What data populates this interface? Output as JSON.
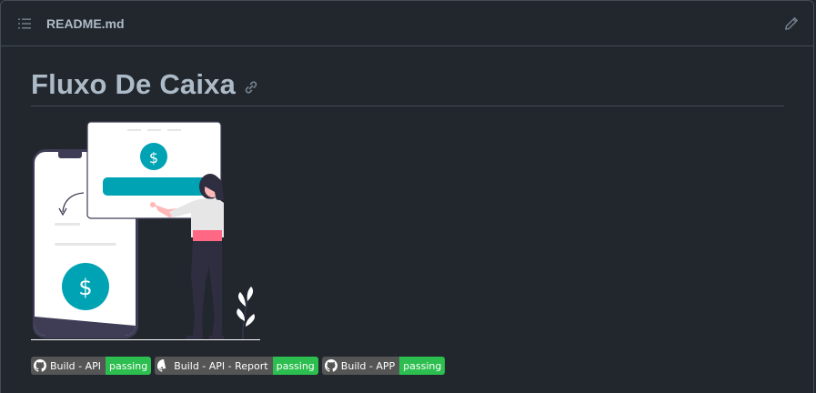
{
  "file": {
    "name": "README.md"
  },
  "readme": {
    "title": "Fluxo De Caixa"
  },
  "illustration": {
    "top_card_symbol": "$",
    "phone_symbol": "$",
    "colors": {
      "accent": "#00a3b4",
      "figure_dark": "#2f2e41",
      "card_bg": "#ffffff"
    }
  },
  "badges": [
    {
      "label": "Build - API",
      "status": "passing"
    },
    {
      "label": "Build - API - Report",
      "status": "passing"
    },
    {
      "label": "Build - APP",
      "status": "passing"
    }
  ],
  "icons": [
    "list-icon",
    "pencil-icon",
    "link-icon",
    "github-icon"
  ],
  "colors": {
    "background": "#22272e",
    "border": "#444c56",
    "text": "#adbac7",
    "badge_label_bg": "#555555",
    "badge_status_bg": "#2cbe4e"
  }
}
